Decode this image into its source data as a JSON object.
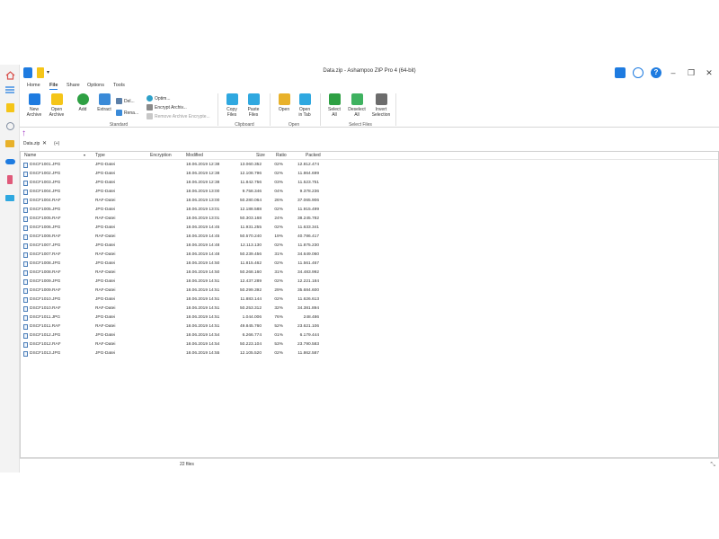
{
  "window": {
    "title": "Data.zip - Ashampoo ZIP Pro 4 (64-bit)"
  },
  "tabs": [
    "Home",
    "File",
    "Share",
    "Options",
    "Tools"
  ],
  "active_tab": "File",
  "ribbon": {
    "standard": {
      "new_archive": "New\nArchive",
      "open_archive": "Open\nArchive",
      "add": "Add",
      "extract": "Extract",
      "delete": "Del...",
      "rename": "Rena...",
      "optimize": "Optim...",
      "encrypt": "Encrypt Archiv...",
      "remove_encryption": "Remove Archive Encrypte...",
      "group": "Standard"
    },
    "clipboard": {
      "copy": "Copy\nFiles",
      "paste": "Paste\nFiles",
      "group": "Clipboard"
    },
    "open": {
      "open": "Open",
      "open_in_tab": "Open\nin Tab",
      "group": "Open"
    },
    "select": {
      "select_all": "Select\nAll",
      "deselect_all": "Deselect\nAll",
      "invert": "Invert\nSelection",
      "group": "Select Files"
    }
  },
  "doc_tab": {
    "label": "Data.zip",
    "add": "(+)"
  },
  "columns": [
    "Name",
    "Type",
    "Encryption",
    "Modified",
    "Size",
    "Ratio",
    "Packed"
  ],
  "files": [
    [
      "DSCF1001.JPG",
      "JPG-Datei",
      "",
      "18.06.2019 12:38",
      "13.060.352",
      "02%",
      "12.812.474"
    ],
    [
      "DSCF1002.JPG",
      "JPG-Datei",
      "",
      "18.06.2019 12:38",
      "12.108.796",
      "02%",
      "11.864.699"
    ],
    [
      "DSCF1003.JPG",
      "JPG-Datei",
      "",
      "18.06.2019 12:38",
      "11.842.756",
      "03%",
      "11.523.751"
    ],
    [
      "DSCF1004.JPG",
      "JPG-Datei",
      "",
      "18.06.2019 13:00",
      "9.758.346",
      "04%",
      "9.378.236"
    ],
    [
      "DSCF1004.RAF",
      "RAF-Datei",
      "",
      "18.06.2019 13:00",
      "50.280.064",
      "26%",
      "37.065.906"
    ],
    [
      "DSCF1005.JPG",
      "JPG-Datei",
      "",
      "18.06.2019 13:01",
      "12.188.588",
      "02%",
      "11.915.499"
    ],
    [
      "DSCF1005.RAF",
      "RAF-Datei",
      "",
      "18.06.2019 13:01",
      "50.303.168",
      "24%",
      "38.245.782"
    ],
    [
      "DSCF1006.JPG",
      "JPG-Datei",
      "",
      "18.06.2019 14:45",
      "11.931.255",
      "02%",
      "11.633.341"
    ],
    [
      "DSCF1006.RAF",
      "RAF-Datei",
      "",
      "18.06.2019 14:45",
      "50.570.240",
      "19%",
      "40.786.417"
    ],
    [
      "DSCF1007.JPG",
      "JPG-Datei",
      "",
      "18.06.2019 14:48",
      "12.113.130",
      "02%",
      "11.875.230"
    ],
    [
      "DSCF1007.RAF",
      "RAF-Datei",
      "",
      "18.06.2019 14:48",
      "50.239.456",
      "31%",
      "34.649.060"
    ],
    [
      "DSCF1008.JPG",
      "JPG-Datei",
      "",
      "18.06.2019 14:50",
      "11.815.462",
      "02%",
      "11.561.467"
    ],
    [
      "DSCF1008.RAF",
      "RAF-Datei",
      "",
      "18.06.2019 14:50",
      "50.268.160",
      "31%",
      "34.483.992"
    ],
    [
      "DSCF1009.JPG",
      "JPG-Datei",
      "",
      "18.06.2019 14:51",
      "12.437.289",
      "02%",
      "12.221.184"
    ],
    [
      "DSCF1009.RAF",
      "RAF-Datei",
      "",
      "18.06.2019 14:51",
      "50.299.392",
      "29%",
      "35.684.600"
    ],
    [
      "DSCF1010.JPG",
      "JPG-Datei",
      "",
      "18.06.2019 14:51",
      "11.883.144",
      "02%",
      "11.626.613"
    ],
    [
      "DSCF1010.RAF",
      "RAF-Datei",
      "",
      "18.06.2019 14:51",
      "50.253.312",
      "32%",
      "34.381.894"
    ],
    [
      "DSCF1011.JPG",
      "JPG-Datei",
      "",
      "18.06.2019 14:51",
      "1.044.006",
      "76%",
      "248.486"
    ],
    [
      "DSCF1011.RAF",
      "RAF-Datei",
      "",
      "18.06.2019 14:51",
      "49.845.760",
      "52%",
      "23.621.106"
    ],
    [
      "DSCF1012.JPG",
      "JPG-Datei",
      "",
      "18.06.2019 14:54",
      "6.266.774",
      "01%",
      "6.179.444"
    ],
    [
      "DSCF1012.RAF",
      "RAF-Datei",
      "",
      "18.06.2019 14:54",
      "50.223.104",
      "53%",
      "23.790.583"
    ],
    [
      "DSCF1013.JPG",
      "JPG-Datei",
      "",
      "18.06.2019 14:55",
      "12.105.520",
      "02%",
      "11.862.587"
    ]
  ],
  "status": {
    "count": "22 files"
  },
  "colors": {
    "accent": "#1e7be0",
    "up_arrow": "#9b2dc1",
    "green": "#2ea043",
    "yellow": "#f5c518"
  }
}
